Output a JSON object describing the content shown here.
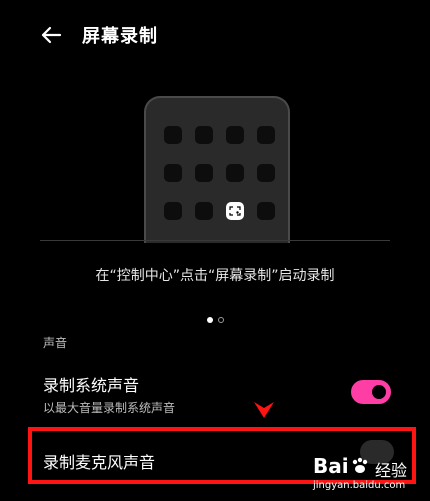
{
  "header": {
    "title": "屏幕录制",
    "back_icon": "arrow-left-icon"
  },
  "illustration": {
    "tile_icon": "screen-record-icon"
  },
  "instruction": "在“控制中心”点击“屏幕录制”启动录制",
  "pager": {
    "count": 2,
    "active": 1
  },
  "sound_section": {
    "label": "声音",
    "items": [
      {
        "title": "录制系统声音",
        "subtitle": "以最大音量录制系统声音",
        "enabled": true
      },
      {
        "title": "录制麦克风声音",
        "enabled": false
      }
    ]
  },
  "colors": {
    "accent": "#ff3ea5",
    "highlight": "#ff1414",
    "background": "#000000"
  },
  "watermark": {
    "logo": "Bai",
    "brand": "经验",
    "url": "jingyan.baidu.com"
  }
}
